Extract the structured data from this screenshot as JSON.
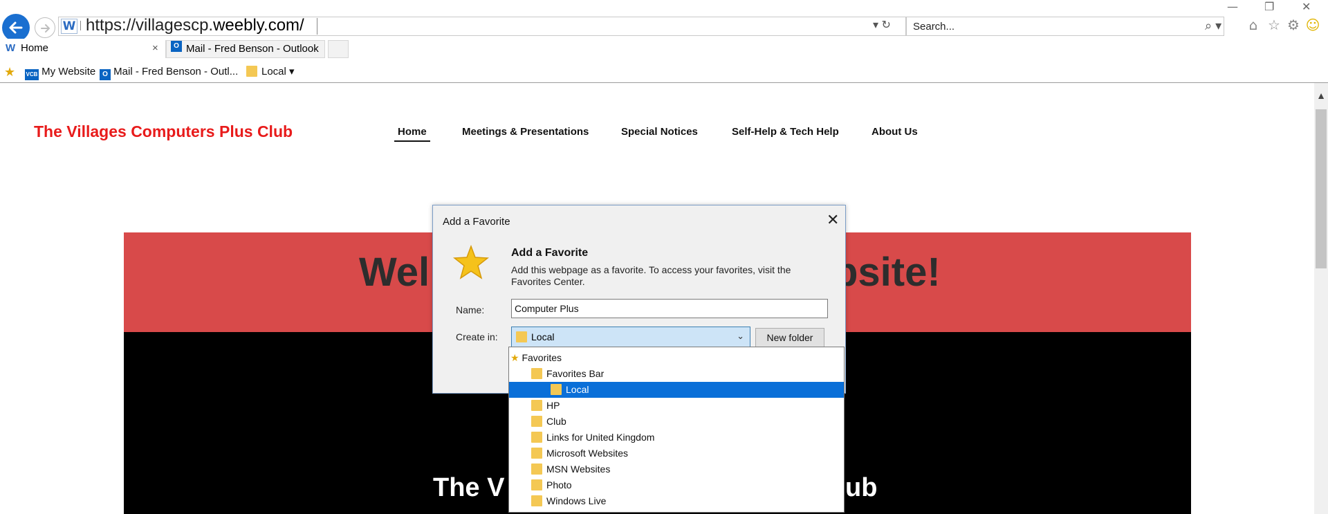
{
  "browser": {
    "url_prefix": "https://villagescp.",
    "url_domain": "weebly.com/",
    "search_placeholder": "Search...",
    "addr_controls": "▾ ↻",
    "tabs": [
      {
        "label": "Home",
        "close": "×"
      },
      {
        "label": "Mail - Fred Benson - Outlook"
      }
    ],
    "favorites_bar": [
      {
        "label": "My Website"
      },
      {
        "label": "Mail - Fred Benson - Outl..."
      },
      {
        "label": "Local ▾"
      }
    ]
  },
  "site": {
    "title": "The Villages Computers Plus Club",
    "nav": [
      "Home",
      "Meetings & Presentations",
      "Special Notices",
      "Self-Help & Tech Help",
      "About Us"
    ],
    "hero_left": "Wel",
    "hero_right": "bsite!",
    "sub_left": "The V",
    "sub_right": "ub"
  },
  "dialog": {
    "title": "Add a Favorite",
    "heading": "Add a Favorite",
    "description": "Add this webpage as a favorite. To access your favorites, visit the Favorites Center.",
    "name_label": "Name:",
    "name_value": "Computer Plus",
    "create_label": "Create in:",
    "create_value": "Local",
    "new_folder": "New folder",
    "folders": [
      {
        "label": "Favorites",
        "level": 0
      },
      {
        "label": "Favorites Bar",
        "level": 1
      },
      {
        "label": "Local",
        "level": 2,
        "selected": true
      },
      {
        "label": "HP",
        "level": 1
      },
      {
        "label": "Club",
        "level": 1
      },
      {
        "label": "Links for United Kingdom",
        "level": 1
      },
      {
        "label": "Microsoft Websites",
        "level": 1
      },
      {
        "label": "MSN Websites",
        "level": 1
      },
      {
        "label": "Photo",
        "level": 1
      },
      {
        "label": "Windows Live",
        "level": 1
      }
    ]
  },
  "colors": {
    "accent": "#0a6fd8",
    "site_title": "#e81b1b",
    "hero_red": "#d84a4a"
  }
}
